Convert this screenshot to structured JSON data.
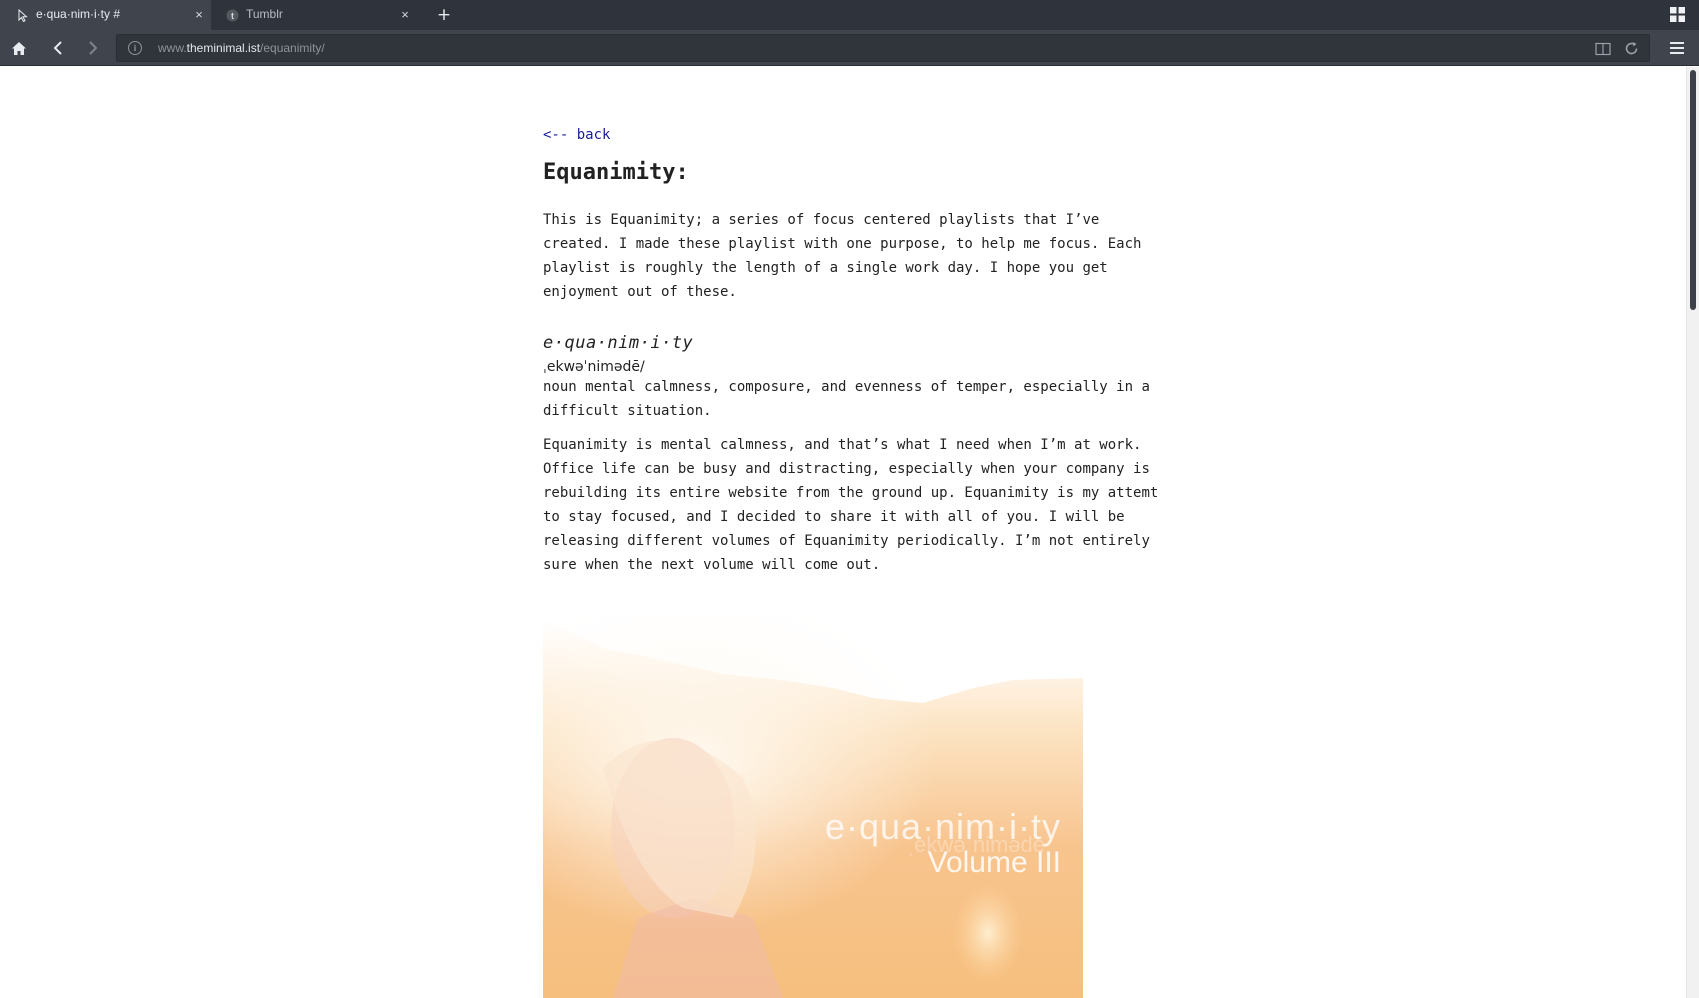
{
  "tabs": [
    {
      "title": "e·qua·nim·i·ty #",
      "close": "×"
    },
    {
      "title": "Tumblr",
      "close": "×",
      "icon": "tumblr-t-icon"
    }
  ],
  "new_tab": "+",
  "address": {
    "prefix": "www.",
    "host": "theminimal.ist",
    "path": "/equanimity/"
  },
  "page": {
    "back": "<-- back",
    "title": "Equanimity:",
    "intro": "This is Equanimity; a series of focus centered playlists that I’ve created. I made these playlist with one purpose, to help me focus. Each playlist is roughly the length of a single work day. I hope you get enjoyment out of these.",
    "definition": {
      "word": "e·qua·nim·i·ty",
      "pronunciation": "ˌekwəˈnimədē/",
      "meaning": "noun mental calmness, composure, and evenness of temper, especially in a difficult situation."
    },
    "explanation": "Equanimity is mental calmness, and that’s what I need when I’m at work. Office life can be busy and distracting, especially when your company is rebuilding its entire website from the ground up. Equanimity is my attemt to stay focused, and I decided to share it with all of you. I will be releasing different volumes of Equanimity periodically. I’m not entirely sure when the next volume will come out.",
    "cover": {
      "word": "e·qua·nim·i·ty",
      "pronunciation": "ˌekwəˈnimədē",
      "volume": "Volume III"
    }
  },
  "colors": {
    "chrome_dark": "#2f333b",
    "chrome": "#3f444d",
    "link": "#1a1a9e",
    "text": "#222222"
  }
}
